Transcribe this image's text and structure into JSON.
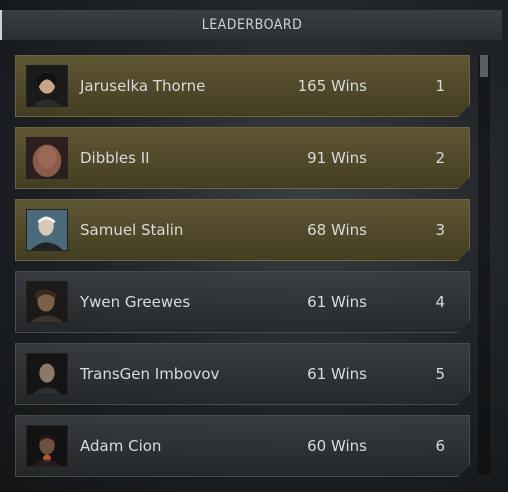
{
  "header": {
    "title": "LEADERBOARD"
  },
  "rows": [
    {
      "name": "Jaruselka Thorne",
      "wins": "165 Wins",
      "rank": "1",
      "highlight": true
    },
    {
      "name": "Dibbles II",
      "wins": "91 Wins",
      "rank": "2",
      "highlight": true
    },
    {
      "name": "Samuel Stalin",
      "wins": "68 Wins",
      "rank": "3",
      "highlight": true
    },
    {
      "name": "Ywen Greewes",
      "wins": "61 Wins",
      "rank": "4",
      "highlight": false
    },
    {
      "name": "TransGen Imbovov",
      "wins": "61 Wins",
      "rank": "5",
      "highlight": false
    },
    {
      "name": "Adam Cion",
      "wins": "60 Wins",
      "rank": "6",
      "highlight": false
    }
  ],
  "colors": {
    "gold_row": "#5f5632",
    "dark_row": "#2f3336",
    "text": "#d9dadb"
  }
}
